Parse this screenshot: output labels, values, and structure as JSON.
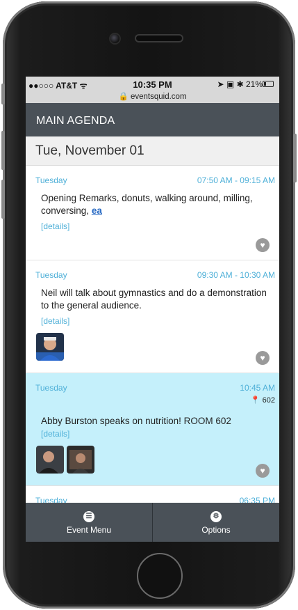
{
  "status_bar": {
    "carrier": "●●○○○ AT&T ᯤ",
    "time": "10:35 PM",
    "right": "➤ ▣ ✱ 21%",
    "battery_level": 0.21,
    "url": "🔒 eventsquid.com"
  },
  "header": {
    "title": "MAIN AGENDA"
  },
  "agenda": {
    "date": "Tue, November 01",
    "sessions": [
      {
        "day": "Tuesday",
        "time": "07:50 AM - 09:15 AM",
        "title": "Opening Remarks, donuts, walking around, milling, conversing,",
        "link": "ea",
        "details": "[details]"
      },
      {
        "day": "Tuesday",
        "time": "09:30 AM - 10:30 AM",
        "title": "Neil will talk about gymnastics and do a demonstration to the general audience.",
        "details": "[details]"
      },
      {
        "day": "Tuesday",
        "time": "10:45 AM",
        "room": "602",
        "title": "Abby Burston speaks on nutrition!  ROOM 602",
        "details": "[details]"
      },
      {
        "day": "Tuesday",
        "time": "06:35 PM"
      }
    ]
  },
  "bottom_bar": {
    "event_menu": "Event Menu",
    "options": "Options"
  },
  "colors": {
    "header_bg": "#4a5158",
    "accent": "#4fb0d8",
    "highlight_bg": "#c5f0fb"
  }
}
